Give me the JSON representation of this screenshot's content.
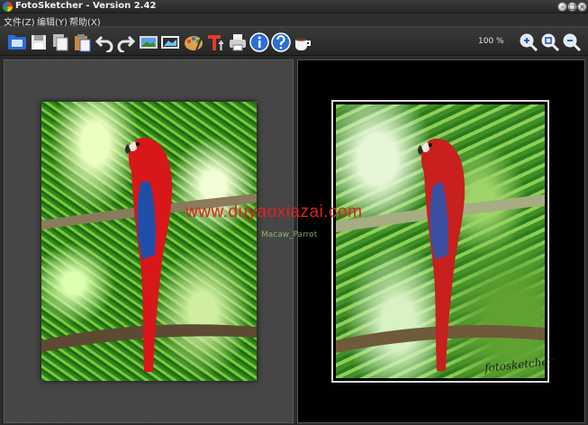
{
  "window": {
    "title": "FotoSketcher - Version 2.42"
  },
  "menu": {
    "file": "文件(Z)",
    "edit": "编辑(Y)",
    "help": "帮助(X)"
  },
  "toolbar": {
    "icons": [
      "open-folder-icon",
      "save-icon",
      "copy-icon",
      "paste-icon",
      "undo-icon",
      "redo-icon",
      "image-landscape-icon",
      "image-frame-icon",
      "palette-icon",
      "text-tool-icon",
      "printer-icon",
      "info-icon",
      "help-icon",
      "coffee-cup-icon",
      "zoom-in-icon",
      "zoom-fit-icon",
      "zoom-out-icon"
    ],
    "zoom_level": "100 %"
  },
  "images": {
    "original": {
      "subject": "scarlet-macaw-on-branch"
    },
    "sketch": {
      "signature": "fotosketcher"
    }
  },
  "overlay": {
    "watermark": "www.duyaoxiazai.com",
    "watermark_sub": "Macaw_Parrot"
  },
  "colors": {
    "titlebar": "#2f2f2f",
    "panel_left": "#474747",
    "panel_right": "#010101",
    "watermark": "#e02020"
  }
}
